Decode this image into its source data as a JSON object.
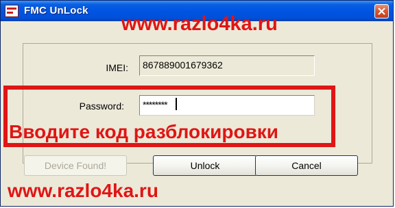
{
  "window": {
    "title": "FMC UnLock"
  },
  "watermark": {
    "url_top": "www.razlo4ka.ru",
    "url_bottom": "www.razlo4ka.ru"
  },
  "form": {
    "imei_label": "IMEI:",
    "imei_value": "867889001679362",
    "password_label": "Password:",
    "password_value": "********"
  },
  "instruction": "Вводите код разблокировки",
  "buttons": {
    "device_found": "Device Found!",
    "unlock": "Unlock",
    "cancel": "Cancel"
  },
  "colors": {
    "accent_red": "#e01515",
    "titlebar_blue": "#0054e3",
    "dialog_bg": "#ece9d8"
  },
  "icons": {
    "app": "app-icon",
    "close": "close-icon"
  }
}
